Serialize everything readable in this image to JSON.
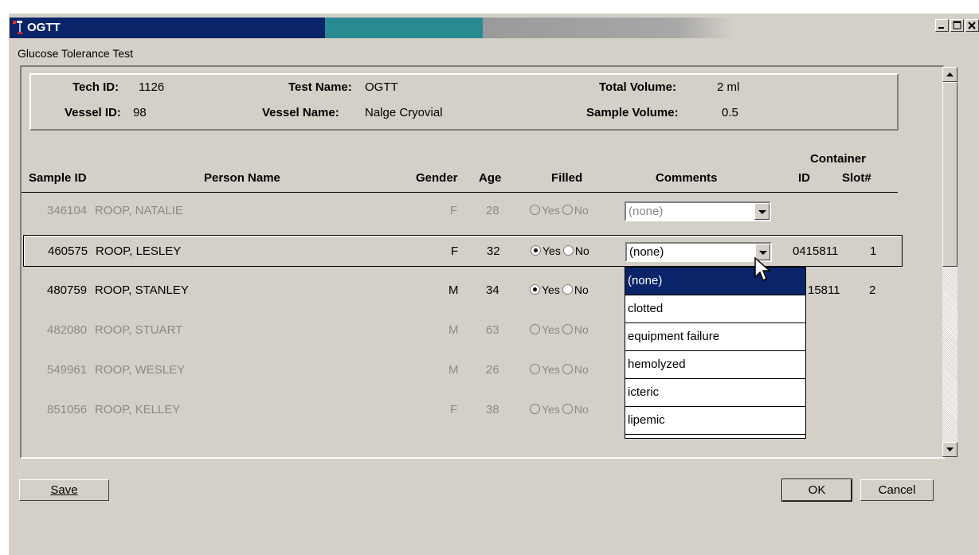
{
  "window": {
    "title": "OGTT",
    "subtitle": "Glucose Tolerance Test",
    "controls": [
      "minimize",
      "maximize",
      "close"
    ]
  },
  "header": {
    "tech_id_label": "Tech ID:",
    "tech_id": "1126",
    "vessel_id_label": "Vessel ID:",
    "vessel_id": "98",
    "test_name_label": "Test Name:",
    "test_name": "OGTT",
    "vessel_name_label": "Vessel Name:",
    "vessel_name": "Nalge Cryovial",
    "total_volume_label": "Total Volume:",
    "total_volume": "2 ml",
    "sample_volume_label": "Sample Volume:",
    "sample_volume": "0.5"
  },
  "columns": {
    "sample_id": "Sample ID",
    "person_name": "Person Name",
    "gender": "Gender",
    "age": "Age",
    "filled": "Filled",
    "comments": "Comments",
    "container": "Container",
    "container_id": "ID",
    "slot": "Slot#"
  },
  "radio_labels": {
    "yes": "Yes",
    "no": "No"
  },
  "rows": [
    {
      "sample_id": "346104",
      "name": "ROOP, NATALIE",
      "gender": "F",
      "age": "28",
      "filled": "",
      "comment": "(none)",
      "container_id": "",
      "slot": "",
      "enabled": false
    },
    {
      "sample_id": "460575",
      "name": "ROOP, LESLEY",
      "gender": "F",
      "age": "32",
      "filled": "yes",
      "comment": "(none)",
      "container_id": "0415811",
      "slot": "1",
      "enabled": true
    },
    {
      "sample_id": "480759",
      "name": "ROOP, STANLEY",
      "gender": "M",
      "age": "34",
      "filled": "yes",
      "comment": "",
      "container_id": "15811",
      "slot": "2",
      "enabled": true
    },
    {
      "sample_id": "482080",
      "name": "ROOP, STUART",
      "gender": "M",
      "age": "63",
      "filled": "",
      "comment": "",
      "container_id": "",
      "slot": "",
      "enabled": false
    },
    {
      "sample_id": "549961",
      "name": "ROOP, WESLEY",
      "gender": "M",
      "age": "26",
      "filled": "",
      "comment": "",
      "container_id": "",
      "slot": "",
      "enabled": false
    },
    {
      "sample_id": "851056",
      "name": "ROOP, KELLEY",
      "gender": "F",
      "age": "38",
      "filled": "",
      "comment": "",
      "container_id": "",
      "slot": "",
      "enabled": false
    }
  ],
  "dropdown": {
    "items": [
      "(none)",
      "clotted",
      "equipment failure",
      "hemolyzed",
      "icteric",
      "lipemic"
    ],
    "highlighted": "(none)"
  },
  "buttons": {
    "save": "Save",
    "ok": "OK",
    "cancel": "Cancel"
  },
  "colors": {
    "title_bar": "#0a246a",
    "face": "#d4d0c8",
    "highlight": "#0a246a"
  }
}
